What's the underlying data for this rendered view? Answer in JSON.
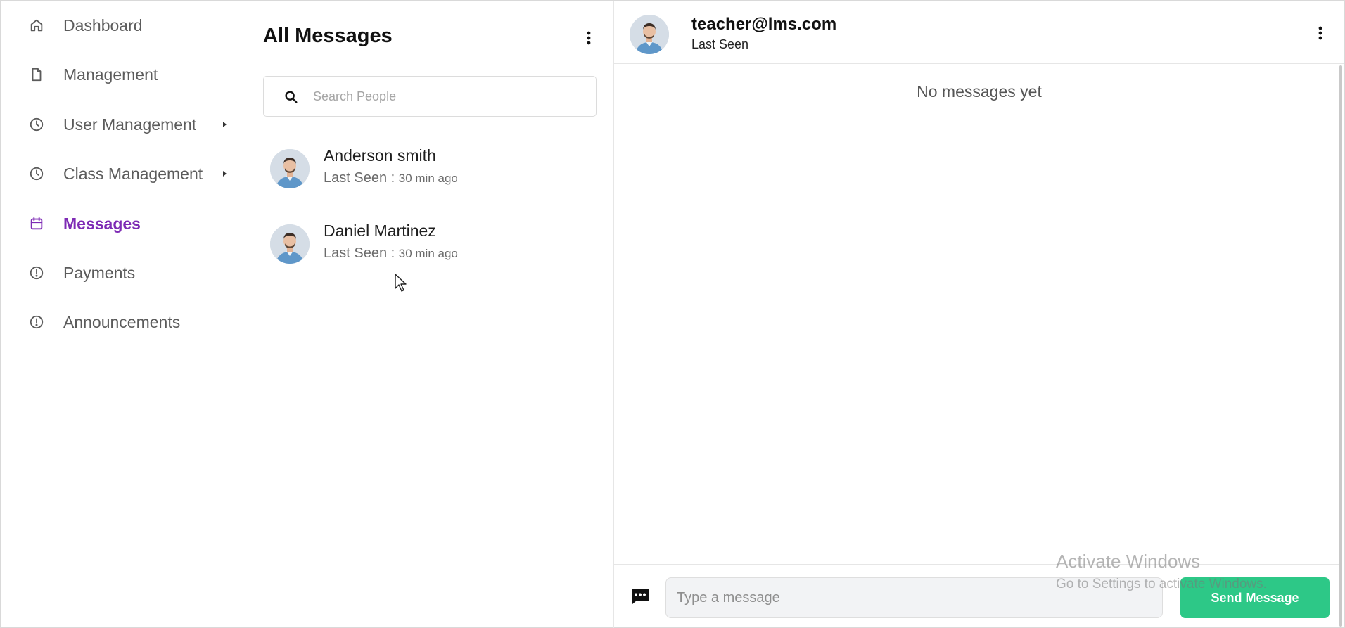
{
  "sidebar": {
    "items": [
      {
        "label": "Dashboard",
        "icon": "home-icon",
        "active": false,
        "has_submenu": false
      },
      {
        "label": "Management",
        "icon": "document-icon",
        "active": false,
        "has_submenu": false
      },
      {
        "label": "User Management",
        "icon": "clock-icon",
        "active": false,
        "has_submenu": true
      },
      {
        "label": "Class Management",
        "icon": "clock-icon",
        "active": false,
        "has_submenu": true
      },
      {
        "label": "Messages",
        "icon": "calendar-icon",
        "active": true,
        "has_submenu": false
      },
      {
        "label": "Payments",
        "icon": "alert-circle-icon",
        "active": false,
        "has_submenu": false
      },
      {
        "label": "Announcements",
        "icon": "alert-circle-icon",
        "active": false,
        "has_submenu": false
      }
    ],
    "active_color": "#7e2bb5",
    "text_color": "#5b5b5b"
  },
  "conversations": {
    "title": "All Messages",
    "search_placeholder": "Search People",
    "contacts": [
      {
        "name": "Anderson smith",
        "seen_label": "Last Seen : ",
        "seen_ago": "30 min ago"
      },
      {
        "name": "Daniel Martinez",
        "seen_label": "Last Seen : ",
        "seen_ago": "30 min ago"
      }
    ]
  },
  "chat": {
    "user": "teacher@lms.com",
    "status": "Last Seen",
    "empty_text": "No messages yet",
    "input_placeholder": "Type a message",
    "send_label": "Send Message",
    "send_color": "#2dc887"
  },
  "watermark": {
    "title": "Activate Windows",
    "subtitle": "Go to Settings to activate Windows."
  }
}
